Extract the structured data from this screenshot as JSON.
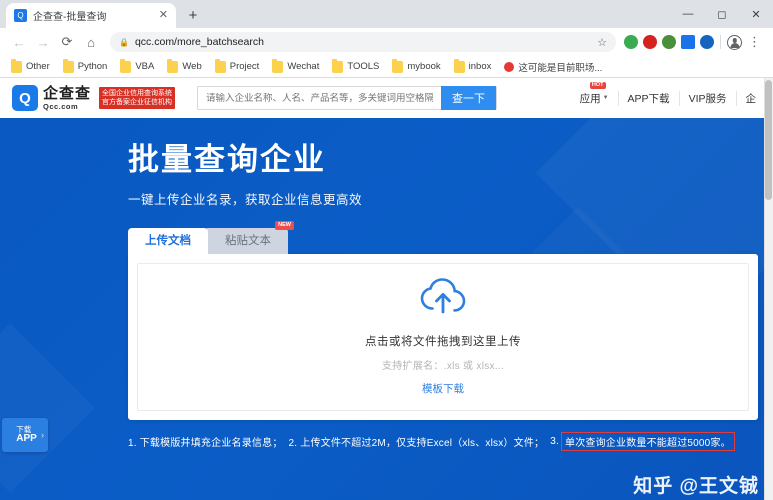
{
  "browser": {
    "tab": {
      "title": "企查查-批量查询",
      "favicon": "qcc-favicon-icon",
      "close_label": "✕"
    },
    "new_tab_label": "+",
    "window_controls": {
      "minimize": "—",
      "maximize": "◻",
      "close": "✕"
    },
    "nav": {
      "back": "←",
      "forward": "→",
      "reload": "⟳",
      "home": "⌂"
    },
    "omnibox": {
      "lock_icon": "🔒",
      "url": "qcc.com/more_batchsearch",
      "star": "☆"
    },
    "extensions": [
      {
        "name": "evernote-extension-icon",
        "color": "#3aab4e"
      },
      {
        "name": "opera-extension-icon",
        "color": "#d6231f"
      },
      {
        "name": "globe-extension-icon",
        "color": "#4a8f3a"
      },
      {
        "name": "blue-square-extension-icon",
        "color": "#1a73e8"
      },
      {
        "name": "blue-circle-extension-icon",
        "color": "#1565c0"
      }
    ],
    "profile_name": "profile-avatar",
    "menu_label": "⋮",
    "bookmarks": [
      {
        "label": "Other",
        "type": "folder"
      },
      {
        "label": "Python",
        "type": "folder"
      },
      {
        "label": "VBA",
        "type": "folder"
      },
      {
        "label": "Web",
        "type": "folder"
      },
      {
        "label": "Project",
        "type": "folder"
      },
      {
        "label": "Wechat",
        "type": "folder"
      },
      {
        "label": "TOOLS",
        "type": "folder"
      },
      {
        "label": "mybook",
        "type": "folder"
      },
      {
        "label": "inbox",
        "type": "folder"
      },
      {
        "label": "这可能是目前职场...",
        "type": "link"
      }
    ]
  },
  "site": {
    "logo": {
      "mark": "Q",
      "cn": "企查查",
      "en": "Qcc.com"
    },
    "cert_line1": "全国企业信用查询系统",
    "cert_line2": "官方备案企业征信机构",
    "search": {
      "placeholder": "请输入企业名称、人名、产品名等，多关键词用空格隔开",
      "value": "",
      "button": "查一下"
    },
    "nav_items": [
      {
        "label": "应用",
        "caret": "▼",
        "badge": "HOT"
      },
      {
        "label": "APP下载",
        "caret": "",
        "badge": ""
      },
      {
        "label": "VIP服务",
        "caret": "",
        "badge": ""
      },
      {
        "label": "企",
        "caret": "",
        "badge": ""
      }
    ]
  },
  "hero": {
    "title": "批量查询企业",
    "subtitle": "一键上传企业名录，获取企业信息更高效",
    "tabs": [
      {
        "label": "上传文档",
        "active": true,
        "badge": ""
      },
      {
        "label": "粘贴文本",
        "active": false,
        "badge": "NEW"
      }
    ],
    "dropzone": {
      "icon": "cloud-upload-icon",
      "main_text": "点击或将文件拖拽到这里上传",
      "sub_text": "支持扩展名：.xls 或 xlsx...",
      "link_text": "模板下载"
    },
    "notes": {
      "item1": "1. 下载模版并填充企业名录信息；",
      "item2": "2. 上传文件不超过2M，仅支持Excel（xls、xlsx）文件；",
      "item3_prefix": "3.",
      "item3_highlight": "单次查询企业数量不能超过5000家。",
      "highlight_color": "#e23b3b"
    },
    "app_float": {
      "line1": "下载",
      "line2": "APP",
      "chevron": "›"
    },
    "watermark": "知乎 @王文铖",
    "bg_color": "#0a58c2"
  }
}
